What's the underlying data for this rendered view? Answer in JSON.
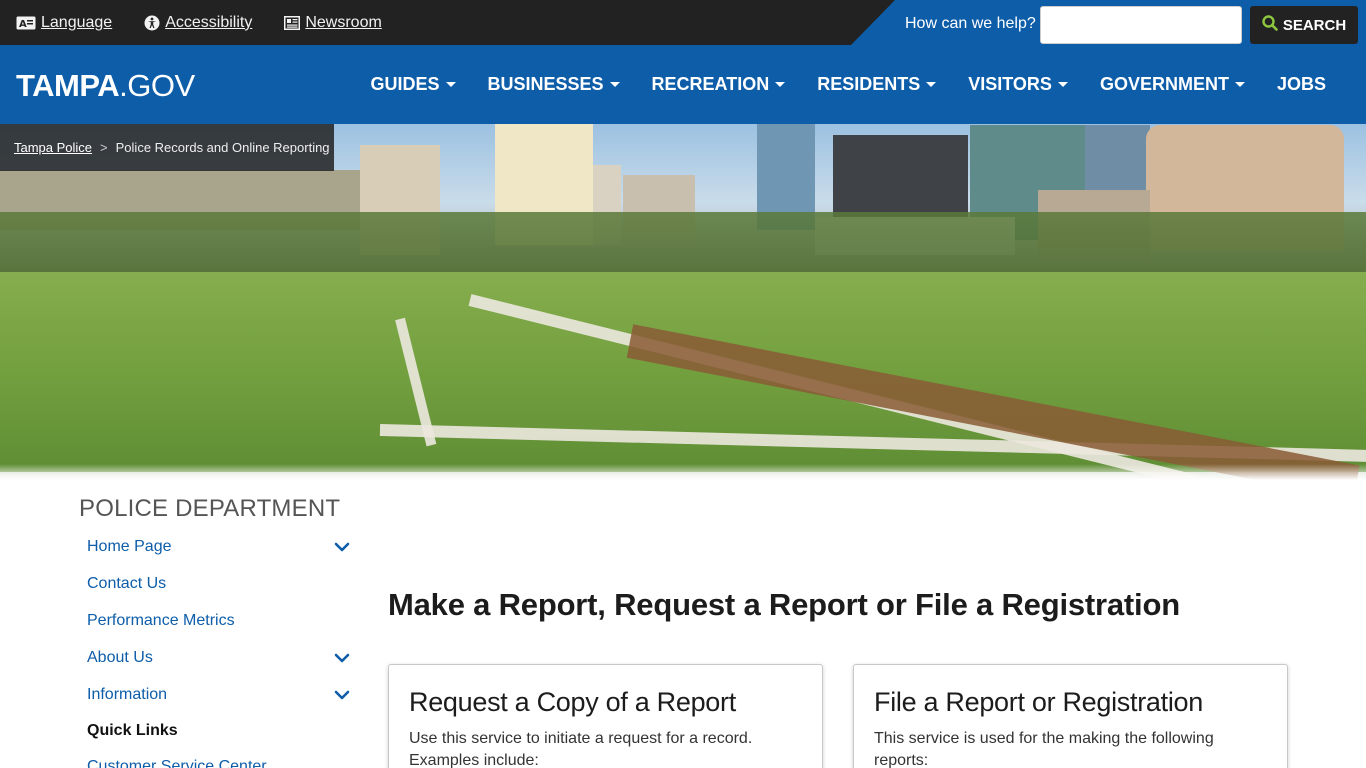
{
  "utility": {
    "links": [
      {
        "label": "Language",
        "icon": "language-icon"
      },
      {
        "label": "Accessibility",
        "icon": "accessibility-icon"
      },
      {
        "label": "Newsroom",
        "icon": "newspaper-icon"
      }
    ],
    "help_label": "How can we help?",
    "search_value": "",
    "search_button": "SEARCH"
  },
  "nav": {
    "logo_bold": "TAMPA",
    "logo_light": ".GOV",
    "items": [
      {
        "label": "GUIDES",
        "dropdown": true
      },
      {
        "label": "BUSINESSES",
        "dropdown": true
      },
      {
        "label": "RECREATION",
        "dropdown": true
      },
      {
        "label": "RESIDENTS",
        "dropdown": true
      },
      {
        "label": "VISITORS",
        "dropdown": true
      },
      {
        "label": "GOVERNMENT",
        "dropdown": true
      },
      {
        "label": "JOBS",
        "dropdown": false
      }
    ]
  },
  "breadcrumb": {
    "link": "Tampa Police",
    "separator": ">",
    "current": "Police Records and Online Reporting"
  },
  "sidebar": {
    "title": "POLICE DEPARTMENT",
    "items": [
      {
        "label": "Home Page",
        "expandable": true
      },
      {
        "label": "Contact Us",
        "expandable": false
      },
      {
        "label": "Performance Metrics",
        "expandable": false
      },
      {
        "label": "About Us",
        "expandable": true
      },
      {
        "label": "Information",
        "expandable": true
      },
      {
        "label": "Quick Links",
        "expandable": false
      },
      {
        "label": "Customer Service Center",
        "expandable": false
      }
    ]
  },
  "main": {
    "title": "Make a Report, Request a Report or File a Registration",
    "cards": [
      {
        "title": "Request a Copy of a Report",
        "text": "Use this service to initiate a request for a record. Examples include:"
      },
      {
        "title": "File a Report or Registration",
        "text": "This service is used for the making the following reports:"
      }
    ]
  },
  "colors": {
    "brand_blue": "#0d5da9",
    "utility_dark": "#222222",
    "search_icon_green": "#8dc63f"
  }
}
